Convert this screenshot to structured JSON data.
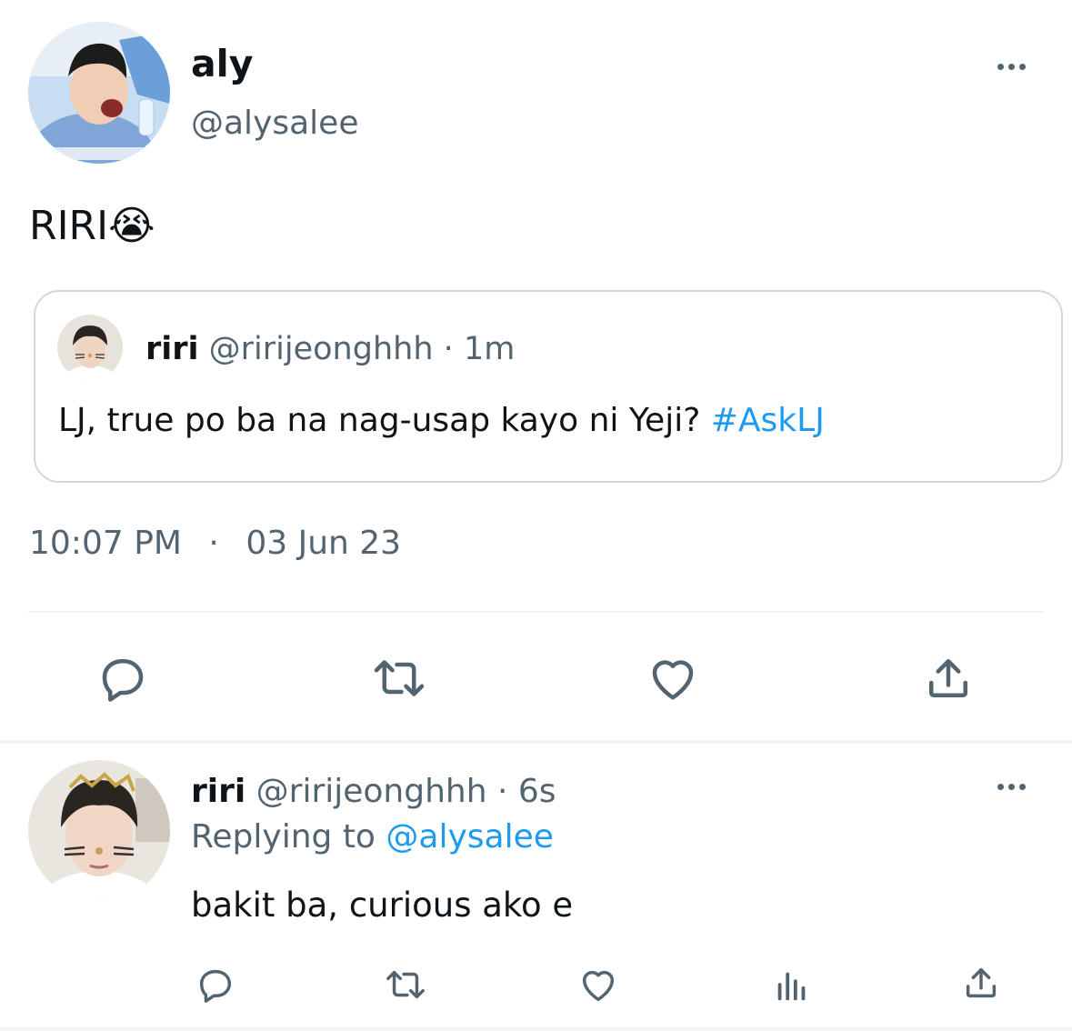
{
  "main_tweet": {
    "display_name": "aly",
    "handle": "@alysalee",
    "text": "RIRI",
    "emoji": "😭",
    "date_time": {
      "time": "10:07 PM",
      "separator": "·",
      "date": "03 Jun 23"
    }
  },
  "quoted_tweet": {
    "display_name": "riri",
    "handle": "@ririjeonghhh",
    "separator": "·",
    "age": "1m",
    "text": "LJ, true po ba na nag-usap kayo ni Yeji? ",
    "hashtag": "#AskLJ"
  },
  "reply_tweet": {
    "display_name": "riri",
    "handle": "@ririjeonghhh",
    "separator": "·",
    "age": "6s",
    "replying_label": "Replying to ",
    "replying_handle": "@alysalee",
    "text": "bakit ba, curious ako e"
  },
  "colors": {
    "accent": "#1d9bf0",
    "secondary_text": "#536471",
    "border": "#cfd9de",
    "divider": "#eff3f4"
  },
  "icons": {
    "main_actions": [
      "reply-icon",
      "retweet-icon",
      "like-icon",
      "share-icon"
    ],
    "reply_actions": [
      "reply-icon",
      "retweet-icon",
      "like-icon",
      "views-icon",
      "share-icon"
    ]
  }
}
